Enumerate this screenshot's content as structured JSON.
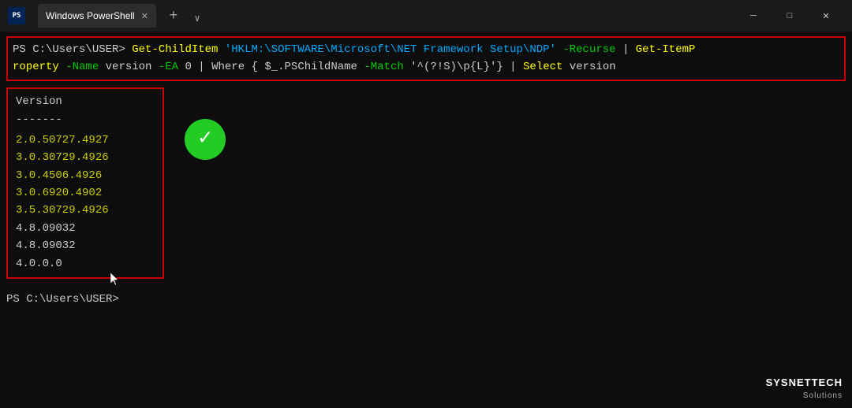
{
  "titlebar": {
    "title": "Windows PowerShell",
    "tab_label": "Windows PowerShell",
    "minimize_label": "─",
    "maximize_label": "□",
    "close_label": "✕",
    "new_tab_label": "+",
    "tab_dropdown_label": "∨"
  },
  "terminal": {
    "prompt1": "PS C:\\Users\\USER> ",
    "command_part1": "Get-ChildItem",
    "command_string": "'HKLM:\\SOFTWARE\\Microsoft\\NET Framework Setup\\NDP'",
    "command_part2": " -Recurse | ",
    "command_part3": "Get-ItemP",
    "command_line2_start": "roperty",
    "command_param1": " -Name",
    "command_val1": " version",
    "command_param2": " -EA",
    "command_val2": " 0 | ",
    "command_where": "Where",
    "command_block": " { $_.PSChildName",
    "command_param3": " -Match",
    "command_regex": " '^(?!S)\\p{L}'}",
    "command_pipe": " | ",
    "command_select": "Select",
    "command_version": " version",
    "output_header": "Version",
    "output_divider": "-------",
    "versions": [
      {
        "value": "2.0.50727.4927",
        "color": "yellow"
      },
      {
        "value": "3.0.30729.4926",
        "color": "yellow"
      },
      {
        "value": "3.0.4506.4926",
        "color": "yellow"
      },
      {
        "value": "3.0.6920.4902",
        "color": "yellow"
      },
      {
        "value": "3.5.30729.4926",
        "color": "yellow"
      },
      {
        "value": "4.8.09032",
        "color": "white"
      },
      {
        "value": "4.8.09032",
        "color": "white"
      },
      {
        "value": "4.0.0.0",
        "color": "white"
      }
    ],
    "prompt2": "PS C:\\Users\\USER> "
  },
  "branding": {
    "name": "SYSNETTECH",
    "subtitle": "Solutions"
  }
}
